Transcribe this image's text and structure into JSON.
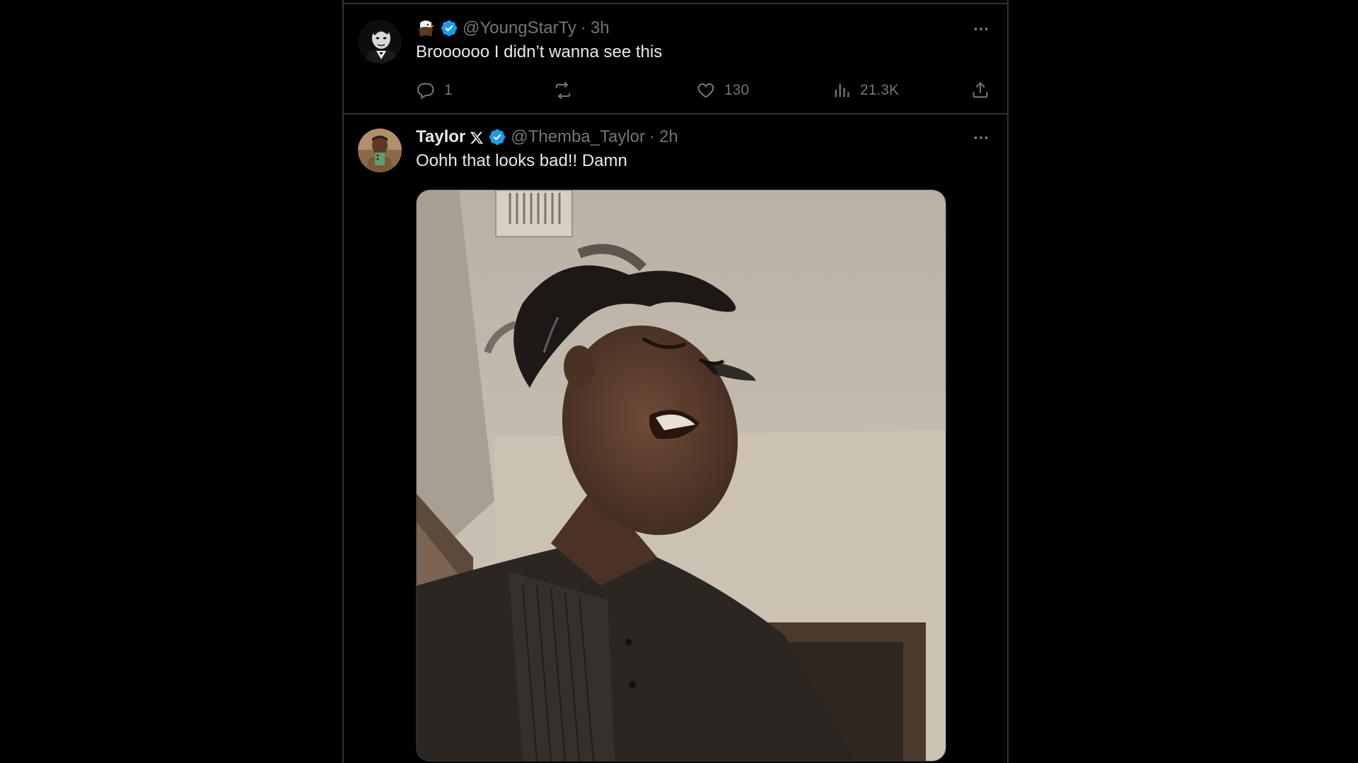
{
  "tweets": [
    {
      "display_name": "",
      "handle": "@YoungStarTy",
      "separator": "·",
      "time": "3h",
      "text": "Broooooo I didn’t wanna see this",
      "avatar_icon": "scarface-portrait-avatar",
      "name_emoji": "eagle-icon",
      "verified": true,
      "actions": {
        "replies": "1",
        "reposts": "",
        "likes": "130",
        "views": "21.3K"
      }
    },
    {
      "display_name": "Taylor",
      "handle": "@Themba_Taylor",
      "separator": "·",
      "time": "2h",
      "text": "Oohh that looks bad!! Damn",
      "avatar_icon": "person-selfie-avatar",
      "name_emoji": "x-logo-icon",
      "verified": true,
      "media": "photo of a person grimacing with hair flying, low angle indoors"
    }
  ],
  "colors": {
    "background": "#000000",
    "border": "#2f3336",
    "text_primary": "#e7e9ea",
    "text_secondary": "#71767b",
    "verified_blue": "#1d9bf0"
  }
}
